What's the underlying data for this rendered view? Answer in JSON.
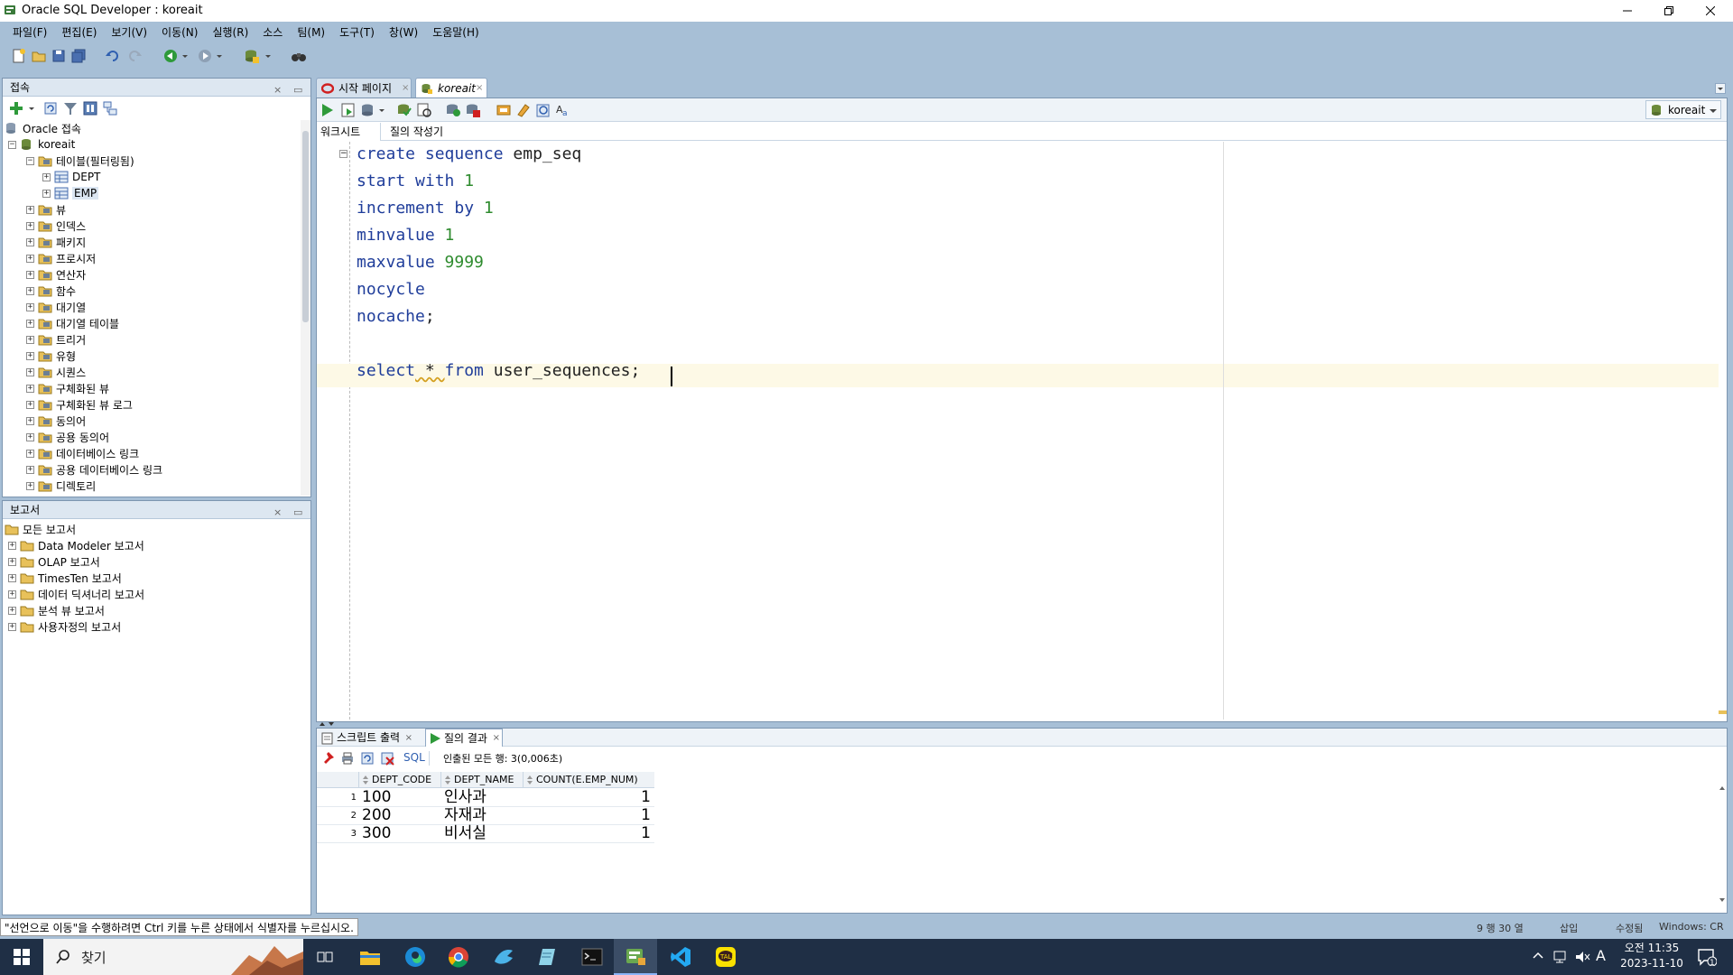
{
  "window": {
    "title": "Oracle SQL Developer : koreait"
  },
  "menu": [
    "파일(F)",
    "편집(E)",
    "보기(V)",
    "이동(N)",
    "실행(R)",
    "소스",
    "팀(M)",
    "도구(T)",
    "창(W)",
    "도움말(H)"
  ],
  "connections": {
    "title": "접속",
    "root": "Oracle 접속",
    "connection": "koreait",
    "items": [
      {
        "label": "테이블(필터링됨)",
        "icon": "table-folder-icon"
      },
      {
        "label": "DEPT",
        "icon": "table-icon"
      },
      {
        "label": "EMP",
        "icon": "table-icon"
      },
      {
        "label": "뷰",
        "icon": "view-folder-icon"
      },
      {
        "label": "인덱스",
        "icon": "index-folder-icon"
      },
      {
        "label": "패키지",
        "icon": "package-folder-icon"
      },
      {
        "label": "프로시저",
        "icon": "procedure-folder-icon"
      },
      {
        "label": "연산자",
        "icon": "operator-folder-icon"
      },
      {
        "label": "함수",
        "icon": "function-folder-icon"
      },
      {
        "label": "대기열",
        "icon": "queue-folder-icon"
      },
      {
        "label": "대기열 테이블",
        "icon": "queue-table-folder-icon"
      },
      {
        "label": "트리거",
        "icon": "trigger-folder-icon"
      },
      {
        "label": "유형",
        "icon": "type-folder-icon"
      },
      {
        "label": "시퀀스",
        "icon": "sequence-folder-icon"
      },
      {
        "label": "구체화된 뷰",
        "icon": "mview-folder-icon"
      },
      {
        "label": "구체화된 뷰 로그",
        "icon": "mview-log-folder-icon"
      },
      {
        "label": "동의어",
        "icon": "synonym-folder-icon"
      },
      {
        "label": "공용 동의어",
        "icon": "public-synonym-folder-icon"
      },
      {
        "label": "데이터베이스 링크",
        "icon": "db-link-folder-icon"
      },
      {
        "label": "공용 데이터베이스 링크",
        "icon": "public-db-link-folder-icon"
      },
      {
        "label": "디렉토리",
        "icon": "directory-folder-icon"
      }
    ]
  },
  "reports": {
    "title": "보고서",
    "root": "모든 보고서",
    "items": [
      "Data Modeler 보고서",
      "OLAP 보고서",
      "TimesTen 보고서",
      "데이터 딕셔너리 보고서",
      "분석 뷰 보고서",
      "사용자정의 보고서"
    ]
  },
  "editor": {
    "tabs": [
      "시작 페이지",
      "koreait"
    ],
    "subtabs": [
      "워크시트",
      "질의 작성기"
    ],
    "connection_selector": "koreait",
    "lines": [
      [
        {
          "t": "create sequence",
          "c": "kw"
        },
        {
          "t": " emp_seq",
          "c": "id"
        }
      ],
      [
        {
          "t": "start with",
          "c": "kw"
        },
        {
          "t": " 1",
          "c": "num"
        }
      ],
      [
        {
          "t": "increment by",
          "c": "kw"
        },
        {
          "t": " 1",
          "c": "num"
        }
      ],
      [
        {
          "t": "minvalue",
          "c": "kw"
        },
        {
          "t": " 1",
          "c": "num"
        }
      ],
      [
        {
          "t": "maxvalue",
          "c": "kw"
        },
        {
          "t": " 9999",
          "c": "num"
        }
      ],
      [
        {
          "t": "nocycle",
          "c": "kw"
        }
      ],
      [
        {
          "t": "nocache",
          "c": "kw"
        },
        {
          "t": ";",
          "c": "id"
        }
      ],
      [],
      [
        {
          "t": "select",
          "c": "kw"
        },
        {
          "t": " * ",
          "c": "star"
        },
        {
          "t": "from",
          "c": "kw"
        },
        {
          "t": " user_sequences;",
          "c": "id"
        }
      ]
    ]
  },
  "results": {
    "tabs": [
      "스크립트 출력",
      "질의 결과"
    ],
    "sql_label": "SQL",
    "status": "인출된 모든 행: 3(0,006초)",
    "columns": [
      "DEPT_CODE",
      "DEPT_NAME",
      "COUNT(E.EMP_NUM)"
    ],
    "rows": [
      [
        "1",
        "100",
        "인사과",
        "1"
      ],
      [
        "2",
        "200",
        "자재과",
        "1"
      ],
      [
        "3",
        "300",
        "비서실",
        "1"
      ]
    ]
  },
  "statusbar": {
    "message": "\"선언으로 이동\"을 수행하려면 Ctrl 키를 누른 상태에서 식별자를 누르십시오.",
    "position": "9 행 30 열",
    "mode": "삽입",
    "modified": "수정됨",
    "line_ending": "Windows: CR"
  },
  "taskbar": {
    "search_label": "찾기",
    "time": "오전 11:35",
    "date": "2023-11-10",
    "ime": "A",
    "notification_count": "1"
  },
  "colors": {
    "chrome": "#a7bfd6",
    "keyword": "#1f3d9a",
    "number": "#2e8b2e",
    "current_line": "#fdf9e6",
    "taskbar": "#1f2f45"
  }
}
